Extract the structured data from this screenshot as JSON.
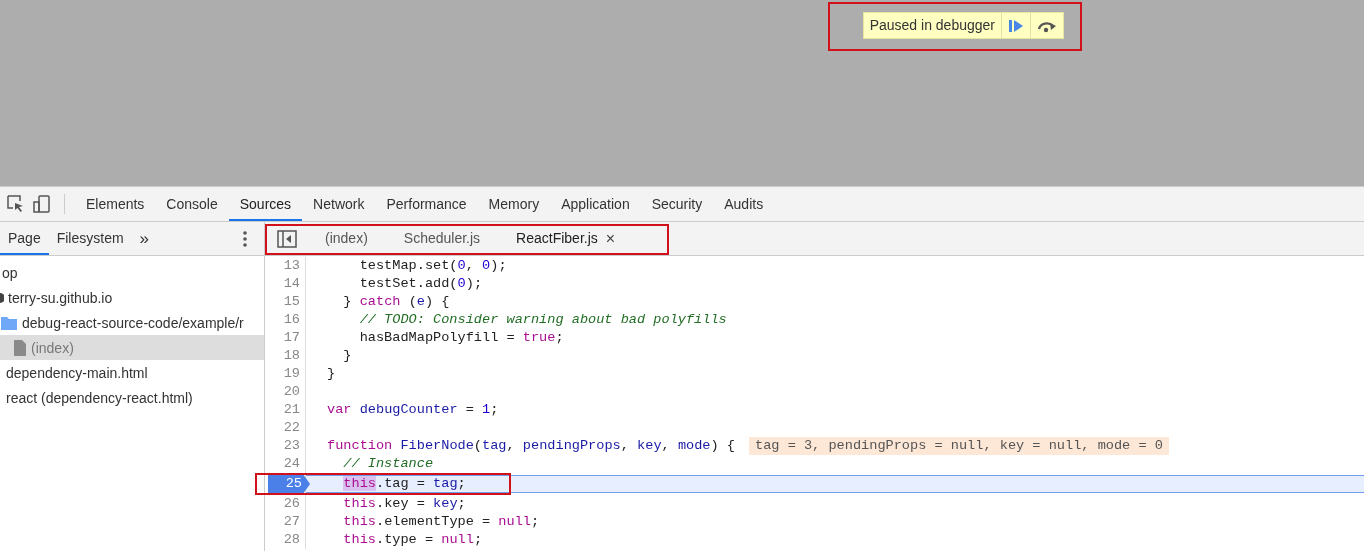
{
  "paused_banner": {
    "message": "Paused in debugger"
  },
  "main_tabs": [
    {
      "label": "Elements",
      "selected": false
    },
    {
      "label": "Console",
      "selected": false
    },
    {
      "label": "Sources",
      "selected": true
    },
    {
      "label": "Network",
      "selected": false
    },
    {
      "label": "Performance",
      "selected": false
    },
    {
      "label": "Memory",
      "selected": false
    },
    {
      "label": "Application",
      "selected": false
    },
    {
      "label": "Security",
      "selected": false
    },
    {
      "label": "Audits",
      "selected": false
    }
  ],
  "navigator_tabs": [
    {
      "label": "Page",
      "selected": true
    },
    {
      "label": "Filesystem",
      "selected": false
    }
  ],
  "navigator_more": "»",
  "file_tree": [
    {
      "label": "op",
      "kind": "frame",
      "selected": false,
      "children": [
        {
          "label": "terry-su.github.io",
          "kind": "domain",
          "selected": false,
          "children": [
            {
              "label": "debug-react-source-code/example/r",
              "kind": "folder",
              "selected": false,
              "children": [
                {
                  "label": "(index)",
                  "kind": "file",
                  "selected": true
                }
              ]
            }
          ]
        },
        {
          "label": "dependency-main.html",
          "kind": "frame",
          "selected": false
        },
        {
          "label": "react (dependency-react.html)",
          "kind": "frame",
          "selected": false
        }
      ]
    }
  ],
  "editor_tabs": [
    {
      "label": "(index)",
      "selected": false,
      "closable": false
    },
    {
      "label": "Scheduler.js",
      "selected": false,
      "closable": false
    },
    {
      "label": "ReactFiber.js",
      "selected": true,
      "closable": true
    }
  ],
  "close_glyph": "×",
  "code_lines": [
    {
      "number": "13",
      "current": false,
      "tokens": [
        {
          "kind": "plain",
          "text": "    testMap.set("
        },
        {
          "kind": "number",
          "text": "0"
        },
        {
          "kind": "plain",
          "text": ", "
        },
        {
          "kind": "number",
          "text": "0"
        },
        {
          "kind": "plain",
          "text": ");"
        }
      ]
    },
    {
      "number": "14",
      "current": false,
      "tokens": [
        {
          "kind": "plain",
          "text": "    testSet.add("
        },
        {
          "kind": "number",
          "text": "0"
        },
        {
          "kind": "plain",
          "text": ");"
        }
      ]
    },
    {
      "number": "15",
      "current": false,
      "tokens": [
        {
          "kind": "plain",
          "text": "  } "
        },
        {
          "kind": "keyword",
          "text": "catch"
        },
        {
          "kind": "plain",
          "text": " ("
        },
        {
          "kind": "variable",
          "text": "e"
        },
        {
          "kind": "plain",
          "text": ") {"
        }
      ]
    },
    {
      "number": "16",
      "current": false,
      "tokens": [
        {
          "kind": "comment",
          "text": "    // TODO: Consider warning about bad polyfills"
        }
      ]
    },
    {
      "number": "17",
      "current": false,
      "tokens": [
        {
          "kind": "plain",
          "text": "    hasBadMapPolyfill = "
        },
        {
          "kind": "keyword",
          "text": "true"
        },
        {
          "kind": "plain",
          "text": ";"
        }
      ]
    },
    {
      "number": "18",
      "current": false,
      "tokens": [
        {
          "kind": "plain",
          "text": "  }"
        }
      ]
    },
    {
      "number": "19",
      "current": false,
      "tokens": [
        {
          "kind": "plain",
          "text": "}"
        }
      ]
    },
    {
      "number": "20",
      "current": false
    },
    {
      "number": "21",
      "current": false,
      "tokens": [
        {
          "kind": "keyword",
          "text": "var"
        },
        {
          "kind": "variable",
          "text": " debugCounter"
        },
        {
          "kind": "plain",
          "text": " = "
        },
        {
          "kind": "number",
          "text": "1"
        },
        {
          "kind": "plain",
          "text": ";"
        }
      ]
    },
    {
      "number": "22",
      "current": false
    },
    {
      "number": "23",
      "current": false,
      "tokens": [
        {
          "kind": "keyword",
          "text": "function"
        },
        {
          "kind": "variable",
          "text": " FiberNode"
        },
        {
          "kind": "plain",
          "text": "("
        },
        {
          "kind": "variable",
          "text": "tag"
        },
        {
          "kind": "plain",
          "text": ", "
        },
        {
          "kind": "variable",
          "text": "pendingProps"
        },
        {
          "kind": "plain",
          "text": ", "
        },
        {
          "kind": "variable",
          "text": "key"
        },
        {
          "kind": "plain",
          "text": ", "
        },
        {
          "kind": "variable",
          "text": "mode"
        },
        {
          "kind": "plain",
          "text": ") {"
        }
      ],
      "inline_values": "tag = 3, pendingProps = null, key = null, mode = 0"
    },
    {
      "number": "24",
      "current": false,
      "tokens": [
        {
          "kind": "comment",
          "text": "  // Instance"
        }
      ]
    },
    {
      "number": "25",
      "current": true,
      "tokens": [
        {
          "kind": "keyword",
          "text": "  this",
          "highlighted": true
        },
        {
          "kind": "plain",
          "text": ".tag = "
        },
        {
          "kind": "variable",
          "text": "tag"
        },
        {
          "kind": "plain",
          "text": ";"
        }
      ]
    },
    {
      "number": "26",
      "current": false,
      "tokens": [
        {
          "kind": "keyword",
          "text": "  this"
        },
        {
          "kind": "plain",
          "text": ".key = "
        },
        {
          "kind": "variable",
          "text": "key"
        },
        {
          "kind": "plain",
          "text": ";"
        }
      ]
    },
    {
      "number": "27",
      "current": false,
      "tokens": [
        {
          "kind": "keyword",
          "text": "  this"
        },
        {
          "kind": "plain",
          "text": ".elementType = "
        },
        {
          "kind": "keyword",
          "text": "null"
        },
        {
          "kind": "plain",
          "text": ";"
        }
      ]
    },
    {
      "number": "28",
      "current": false,
      "tokens": [
        {
          "kind": "keyword",
          "text": "  this"
        },
        {
          "kind": "plain",
          "text": ".type = "
        },
        {
          "kind": "keyword",
          "text": "null"
        },
        {
          "kind": "plain",
          "text": ";"
        }
      ]
    }
  ]
}
